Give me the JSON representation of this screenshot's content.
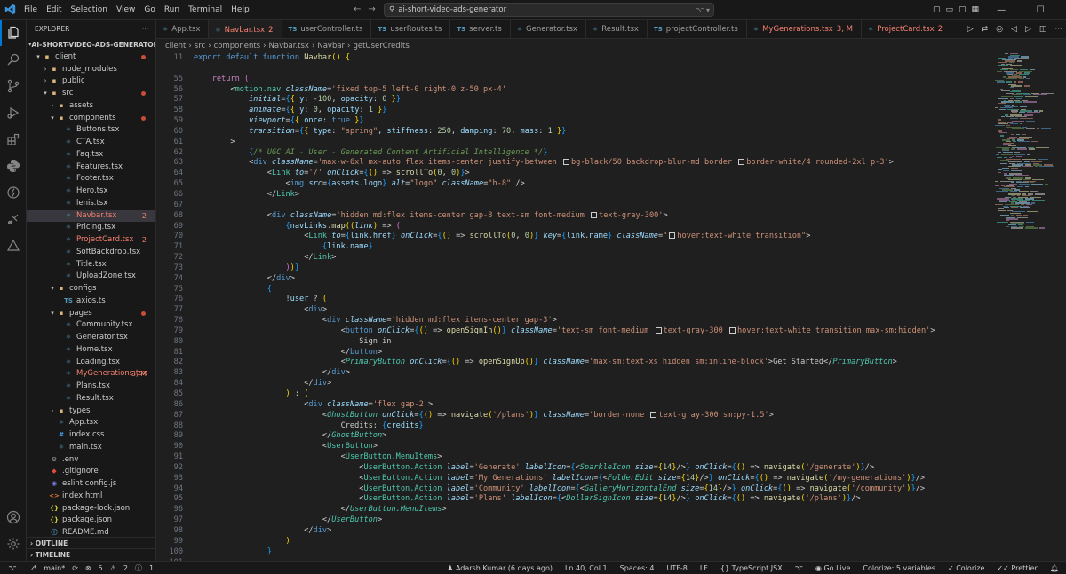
{
  "menu": [
    "File",
    "Edit",
    "Selection",
    "View",
    "Go",
    "Run",
    "Terminal",
    "Help"
  ],
  "command_center": {
    "text": "ai-short-video-ads-generator"
  },
  "explorer": {
    "title": "EXPLORER",
    "root": "AI-SHORT-VIDEO-ADS-GENERATOR",
    "items": [
      {
        "label": "client",
        "depth": 0,
        "type": "folder",
        "open": true,
        "dot": true
      },
      {
        "label": "node_modules",
        "depth": 1,
        "type": "folder",
        "open": false
      },
      {
        "label": "public",
        "depth": 1,
        "type": "folder",
        "open": false
      },
      {
        "label": "src",
        "depth": 1,
        "type": "folder",
        "open": true,
        "dot": true
      },
      {
        "label": "assets",
        "depth": 2,
        "type": "folder",
        "open": false
      },
      {
        "label": "components",
        "depth": 2,
        "type": "folder",
        "open": true,
        "dot": true
      },
      {
        "label": "Buttons.tsx",
        "depth": 3,
        "type": "tsx"
      },
      {
        "label": "CTA.tsx",
        "depth": 3,
        "type": "tsx"
      },
      {
        "label": "Faq.tsx",
        "depth": 3,
        "type": "tsx"
      },
      {
        "label": "Features.tsx",
        "depth": 3,
        "type": "tsx"
      },
      {
        "label": "Footer.tsx",
        "depth": 3,
        "type": "tsx"
      },
      {
        "label": "Hero.tsx",
        "depth": 3,
        "type": "tsx"
      },
      {
        "label": "lenis.tsx",
        "depth": 3,
        "type": "tsx"
      },
      {
        "label": "Navbar.tsx",
        "depth": 3,
        "type": "tsx",
        "badge": "2",
        "status": "err",
        "selected": true
      },
      {
        "label": "Pricing.tsx",
        "depth": 3,
        "type": "tsx"
      },
      {
        "label": "ProjectCard.tsx",
        "depth": 3,
        "type": "tsx",
        "badge": "2",
        "status": "err"
      },
      {
        "label": "SoftBackdrop.tsx",
        "depth": 3,
        "type": "tsx"
      },
      {
        "label": "Title.tsx",
        "depth": 3,
        "type": "tsx"
      },
      {
        "label": "UploadZone.tsx",
        "depth": 3,
        "type": "tsx"
      },
      {
        "label": "configs",
        "depth": 2,
        "type": "folder",
        "open": true
      },
      {
        "label": "axios.ts",
        "depth": 3,
        "type": "ts"
      },
      {
        "label": "pages",
        "depth": 2,
        "type": "folder",
        "open": true,
        "dot": true
      },
      {
        "label": "Community.tsx",
        "depth": 3,
        "type": "tsx"
      },
      {
        "label": "Generator.tsx",
        "depth": 3,
        "type": "tsx"
      },
      {
        "label": "Home.tsx",
        "depth": 3,
        "type": "tsx"
      },
      {
        "label": "Loading.tsx",
        "depth": 3,
        "type": "tsx"
      },
      {
        "label": "MyGenerations.tsx",
        "depth": 3,
        "type": "tsx",
        "badge": "3, M",
        "status": "err"
      },
      {
        "label": "Plans.tsx",
        "depth": 3,
        "type": "tsx"
      },
      {
        "label": "Result.tsx",
        "depth": 3,
        "type": "tsx"
      },
      {
        "label": "types",
        "depth": 2,
        "type": "folder",
        "open": false
      },
      {
        "label": "App.tsx",
        "depth": 2,
        "type": "tsx"
      },
      {
        "label": "index.css",
        "depth": 2,
        "type": "css"
      },
      {
        "label": "main.tsx",
        "depth": 2,
        "type": "tsx"
      },
      {
        "label": ".env",
        "depth": 1,
        "type": "env"
      },
      {
        "label": ".gitignore",
        "depth": 1,
        "type": "git"
      },
      {
        "label": "eslint.config.js",
        "depth": 1,
        "type": "eslint"
      },
      {
        "label": "index.html",
        "depth": 1,
        "type": "html"
      },
      {
        "label": "package-lock.json",
        "depth": 1,
        "type": "json"
      },
      {
        "label": "package.json",
        "depth": 1,
        "type": "json"
      },
      {
        "label": "README.md",
        "depth": 1,
        "type": "md"
      }
    ],
    "sections": [
      "OUTLINE",
      "TIMELINE"
    ]
  },
  "tabs": [
    {
      "label": "App.tsx",
      "status": ""
    },
    {
      "label": "Navbar.tsx",
      "badge": "2",
      "status": "active"
    },
    {
      "label": "userController.ts",
      "status": ""
    },
    {
      "label": "userRoutes.ts",
      "status": ""
    },
    {
      "label": "server.ts",
      "status": ""
    },
    {
      "label": "Generator.tsx",
      "status": ""
    },
    {
      "label": "Result.tsx",
      "status": ""
    },
    {
      "label": "projectController.ts",
      "status": ""
    },
    {
      "label": "MyGenerations.tsx",
      "badge": "3, M",
      "status": "err"
    },
    {
      "label": "ProjectCard.tsx",
      "badge": "2",
      "status": "err"
    }
  ],
  "breadcrumb": [
    "client",
    "src",
    "components",
    "Navbar.tsx",
    "Navbar",
    "getUserCredits"
  ],
  "code": {
    "line_numbers": [
      "11",
      "",
      "55",
      "56",
      "57",
      "58",
      "59",
      "60",
      "61",
      "62",
      "63",
      "64",
      "65",
      "66",
      "67",
      "68",
      "69",
      "70",
      "71",
      "72",
      "73",
      "74",
      "75",
      "76",
      "77",
      "78",
      "79",
      "80",
      "81",
      "82",
      "83",
      "84",
      "85",
      "86",
      "87",
      "88",
      "89",
      "90",
      "91",
      "92",
      "93",
      "94",
      "95",
      "96",
      "97",
      "98",
      "99",
      "100",
      "101"
    ]
  },
  "statusbar": {
    "branch": "main*",
    "errors": "5",
    "warnings": "2",
    "info": "1",
    "blame": "Adarsh Kumar (6 days ago)",
    "position": "Ln 40, Col 1",
    "spaces": "Spaces: 4",
    "encoding": "UTF-8",
    "eol": "LF",
    "language": "TypeScript JSX",
    "golive": "Go Live",
    "colorize": "Colorize: 5 variables",
    "colorize2": "Colorize",
    "prettier": "Prettier"
  }
}
